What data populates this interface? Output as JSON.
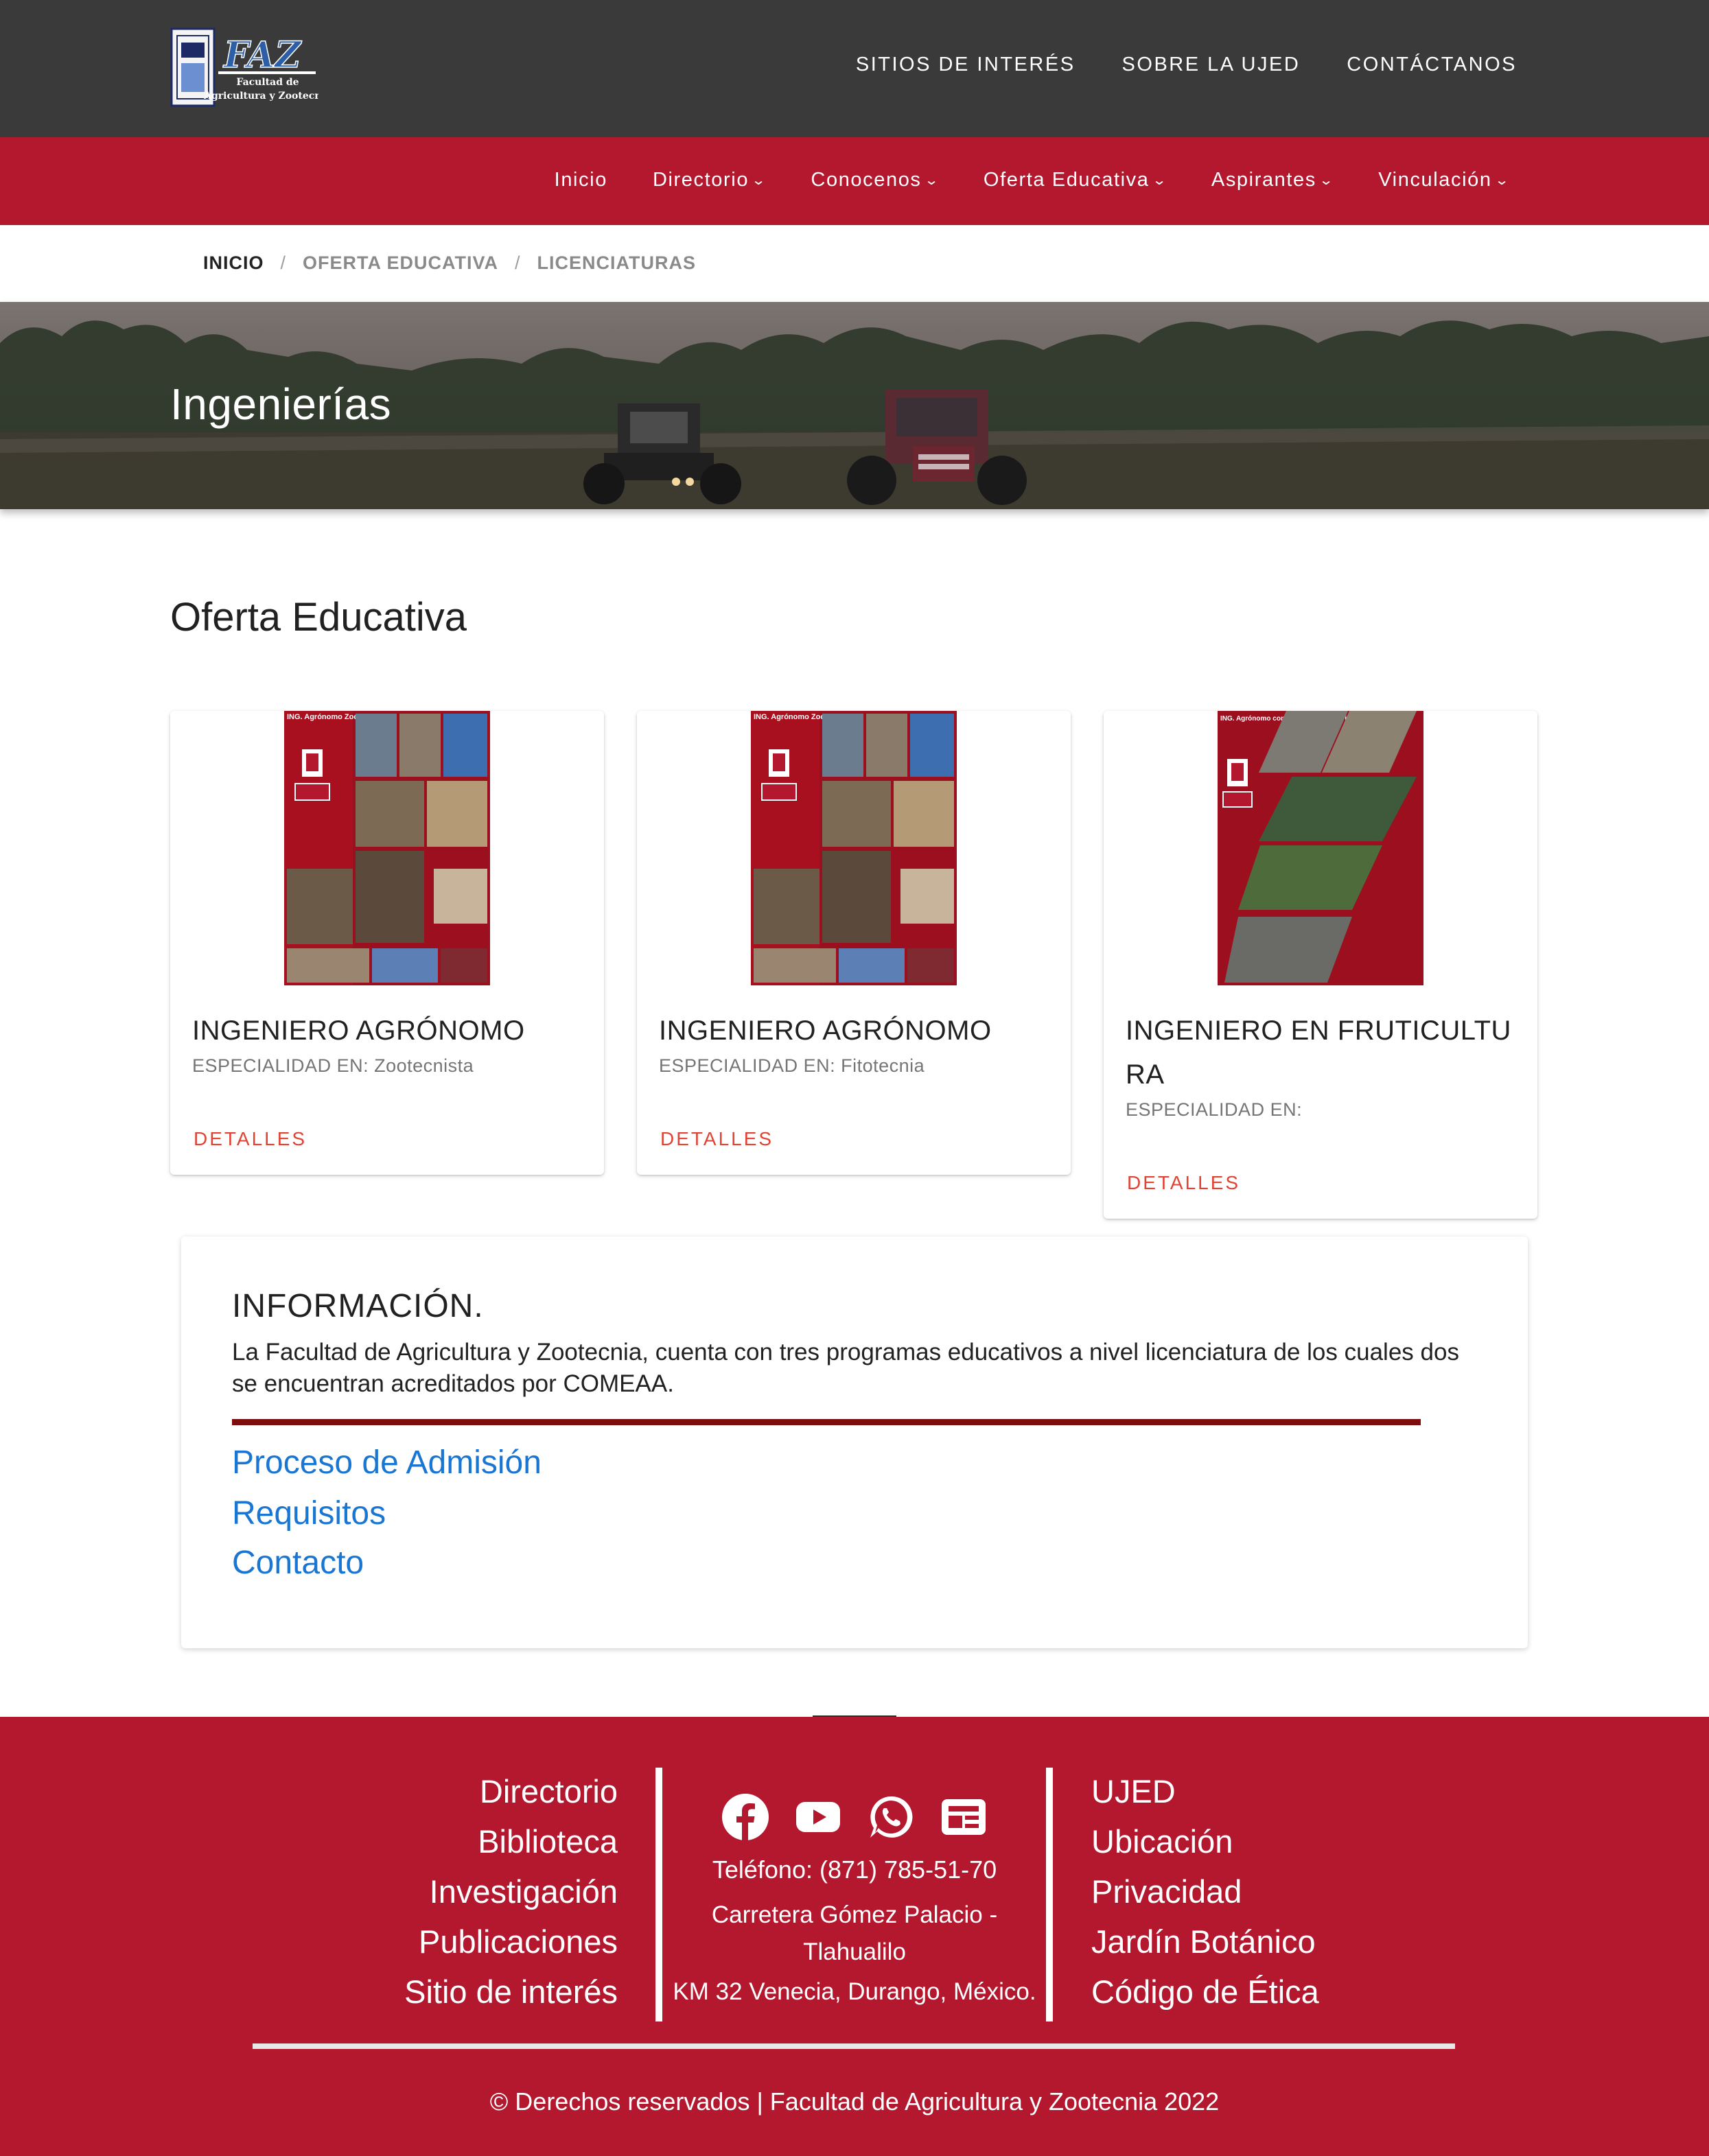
{
  "header": {
    "logo_text": "FAZ",
    "logo_subtitle": "Facultad de Agricultura y Zootecnia",
    "top_links": [
      "SITIOS DE INTERÉS",
      "SOBRE LA UJED",
      "CONTÁCTANOS"
    ]
  },
  "nav": {
    "items": [
      {
        "label": "Inicio",
        "dropdown": false
      },
      {
        "label": "Directorio",
        "dropdown": true
      },
      {
        "label": "Conocenos",
        "dropdown": true
      },
      {
        "label": "Oferta Educativa",
        "dropdown": true
      },
      {
        "label": "Aspirantes",
        "dropdown": true
      },
      {
        "label": "Vinculación",
        "dropdown": true
      }
    ]
  },
  "breadcrumb": {
    "items": [
      "INICIO",
      "OFERTA EDUCATIVA",
      "LICENCIATURAS"
    ],
    "separator": "/"
  },
  "hero": {
    "title": "Ingenierías"
  },
  "section": {
    "title": "Oferta Educativa"
  },
  "cards": [
    {
      "title": "INGENIERO AGRÓNOMO",
      "subtitle": "ESPECIALIDAD EN: Zootecnista",
      "button": "DETALLES",
      "poster_heading": "ING. Agrónomo Zootecnista"
    },
    {
      "title": "INGENIERO AGRÓNOMO",
      "subtitle": "ESPECIALIDAD EN: Fitotecnia",
      "button": "DETALLES",
      "poster_heading": "ING. Agrónomo Zootecnista"
    },
    {
      "title": "INGENIERO EN FRUTICULTURA",
      "subtitle": "ESPECIALIDAD EN:",
      "button": "DETALLES",
      "poster_heading": "ING. Agrónomo con Especialidad en Fitotecnia"
    }
  ],
  "info": {
    "title": "INFORMACIÓN.",
    "text": "La Facultad de Agricultura y Zootecnia, cuenta con tres programas educativos a nivel licenciatura de los cuales dos se encuentran acreditados por COMEAA.",
    "links": [
      "Proceso de Admisión",
      "Requisitos",
      "Contacto"
    ]
  },
  "footer": {
    "left_links": [
      "Directorio",
      "Biblioteca",
      "Investigación",
      "Publicaciones",
      "Sitio de interés"
    ],
    "right_links": [
      "UJED",
      "Ubicación",
      "Privacidad",
      "Jardín Botánico",
      "Código de Ética"
    ],
    "social_icons": [
      "facebook-icon",
      "youtube-icon",
      "whatsapp-icon",
      "news-icon"
    ],
    "phone": "Teléfono: (871) 785-51-70",
    "address_line1": "Carretera Gómez Palacio - Tlahualilo",
    "address_line2": "KM 32 Venecia, Durango, México.",
    "copyright": "© Derechos reservados | Facultad de Agricultura y Zootecnia 2022"
  },
  "colors": {
    "topbar": "#3a3a3a",
    "brand_red": "#b4182f",
    "info_rule": "#7d0d0d",
    "link_blue": "#1976d2",
    "button_red": "#e04434"
  }
}
